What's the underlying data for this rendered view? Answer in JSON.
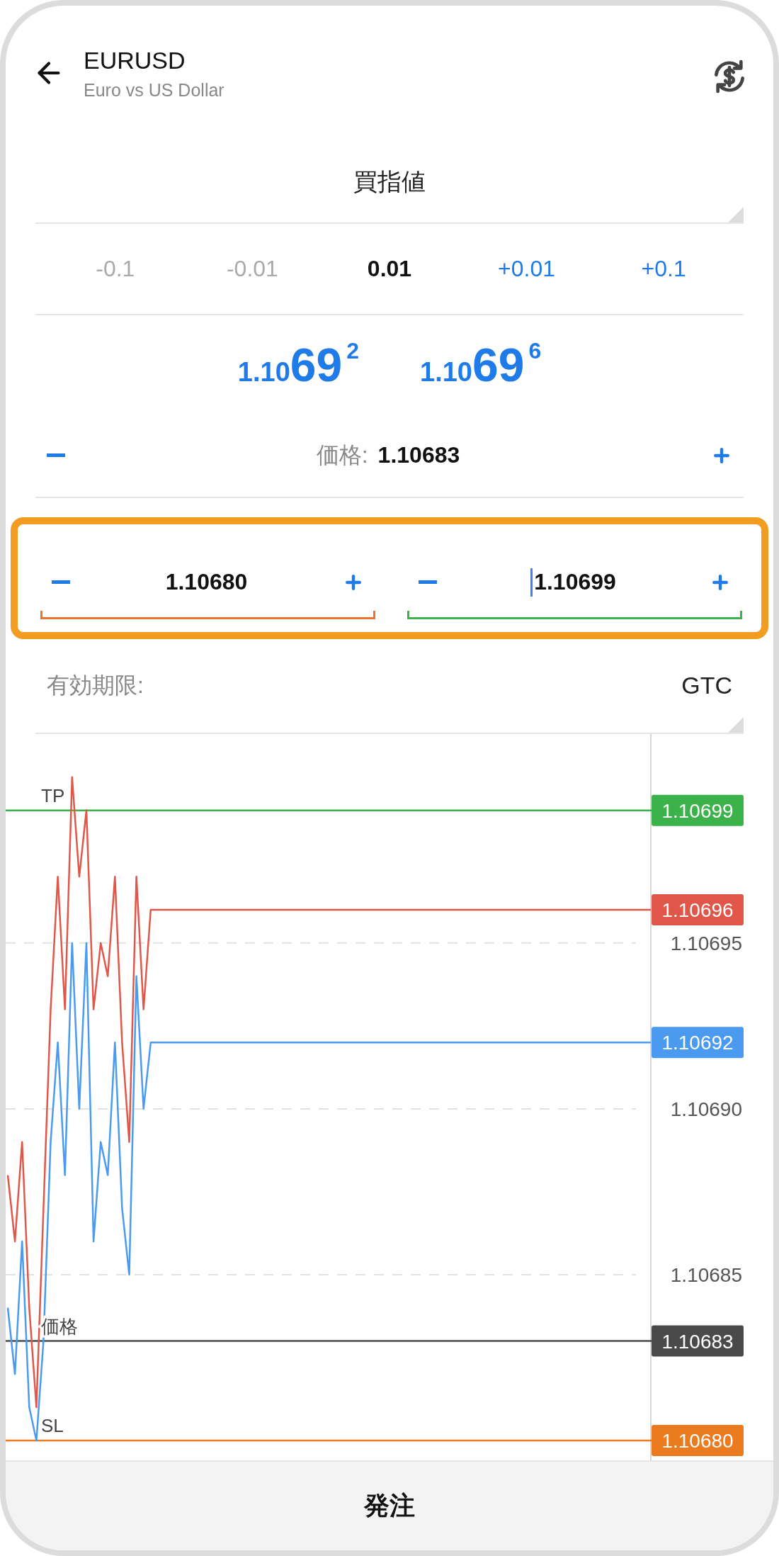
{
  "header": {
    "title": "EURUSD",
    "subtitle": "Euro vs US Dollar"
  },
  "order_type": {
    "value": "買指値"
  },
  "steps": [
    {
      "label": "-0.1",
      "selected": false,
      "disabled": true
    },
    {
      "label": "-0.01",
      "selected": false,
      "disabled": true
    },
    {
      "label": "0.01",
      "selected": true,
      "disabled": false
    },
    {
      "label": "+0.01",
      "selected": false,
      "disabled": false
    },
    {
      "label": "+0.1",
      "selected": false,
      "disabled": false
    }
  ],
  "quotes": [
    {
      "prefix": "1.10",
      "pips": "69",
      "fraction": "2"
    },
    {
      "prefix": "1.10",
      "pips": "69",
      "fraction": "6"
    }
  ],
  "price": {
    "label": "価格:",
    "value": "1.10683"
  },
  "sl_tp": {
    "highlighted": true,
    "fields": [
      {
        "value": "1.10680",
        "color": "#e8762b",
        "focused": false
      },
      {
        "value": "1.10699",
        "color": "#3cb34a",
        "focused": true
      }
    ]
  },
  "expiry": {
    "label": "有効期限:",
    "value": "GTC"
  },
  "chart": {
    "chart_data": {
      "type": "line",
      "categories": [
        null,
        null,
        null,
        null,
        null,
        null,
        null,
        null,
        null,
        null,
        null,
        null,
        null,
        null,
        null,
        null,
        null,
        null,
        null,
        null,
        null,
        null,
        null,
        null,
        null,
        null,
        null,
        null,
        null,
        null,
        null,
        null,
        null,
        null,
        null,
        null,
        null,
        null,
        null,
        null,
        null,
        null,
        null,
        null,
        null,
        null,
        null,
        null,
        null,
        null,
        null,
        null,
        null,
        null,
        null,
        null,
        null,
        null,
        null,
        null,
        null,
        null,
        null,
        null,
        null,
        null,
        null,
        null,
        null,
        null,
        null,
        null,
        null,
        null,
        null,
        null,
        null,
        null,
        null,
        null,
        null,
        null,
        null,
        null,
        null,
        null,
        null,
        null,
        null,
        null,
        null
      ],
      "grid": true,
      "ylim": [
        1.106794,
        1.107013
      ],
      "yticks": [
        {
          "value": 1.10685,
          "label": "1.10685"
        },
        {
          "value": 1.1069,
          "label": "1.10690"
        },
        {
          "value": 1.10695,
          "label": "1.10695"
        }
      ],
      "series": [
        {
          "color": "#e0574a",
          "values": [
            1.10688,
            1.10686,
            1.10689,
            1.10684,
            1.10681,
            1.10687,
            1.10693,
            1.10697,
            1.10693,
            1.107,
            1.10697,
            1.10699,
            1.10693,
            1.10695,
            1.10694,
            1.10697,
            1.10692,
            1.10689,
            1.10697,
            1.10693,
            1.10696,
            1.10696,
            1.10696,
            1.10696,
            1.10696,
            1.10696,
            1.10696,
            1.10696,
            1.10696,
            1.10696,
            1.10696,
            1.10696,
            1.10696,
            1.10696,
            1.10696,
            1.10696,
            1.10696,
            1.10696,
            1.10696,
            1.10696,
            1.10696,
            1.10696,
            1.10696,
            1.10696,
            1.10696,
            1.10696,
            1.10696,
            1.10696,
            1.10696,
            1.10696,
            1.10696,
            1.10696,
            1.10696,
            1.10696,
            1.10696,
            1.10696,
            1.10696,
            1.10696,
            1.10696,
            1.10696,
            1.10696,
            1.10696,
            1.10696,
            1.10696,
            1.10696,
            1.10696,
            1.10696,
            1.10696,
            1.10696,
            1.10696,
            1.10696,
            1.10696,
            1.10696,
            1.10696,
            1.10696,
            1.10696,
            1.10696,
            1.10696,
            1.10696,
            1.10696,
            1.10696,
            1.10696,
            1.10696,
            1.10696,
            1.10696,
            1.10696,
            1.10696,
            1.10696,
            1.10696,
            1.10696,
            1.10696
          ]
        },
        {
          "color": "#4a9bf0",
          "values": [
            1.10684,
            1.10682,
            1.10686,
            1.10681,
            1.1068,
            1.10683,
            1.10689,
            1.10692,
            1.10688,
            1.10695,
            1.1069,
            1.10695,
            1.10686,
            1.10689,
            1.10688,
            1.10692,
            1.10687,
            1.10685,
            1.10694,
            1.1069,
            1.10692,
            1.10692,
            1.10692,
            1.10692,
            1.10692,
            1.10692,
            1.10692,
            1.10692,
            1.10692,
            1.10692,
            1.10692,
            1.10692,
            1.10692,
            1.10692,
            1.10692,
            1.10692,
            1.10692,
            1.10692,
            1.10692,
            1.10692,
            1.10692,
            1.10692,
            1.10692,
            1.10692,
            1.10692,
            1.10692,
            1.10692,
            1.10692,
            1.10692,
            1.10692,
            1.10692,
            1.10692,
            1.10692,
            1.10692,
            1.10692,
            1.10692,
            1.10692,
            1.10692,
            1.10692,
            1.10692,
            1.10692,
            1.10692,
            1.10692,
            1.10692,
            1.10692,
            1.10692,
            1.10692,
            1.10692,
            1.10692,
            1.10692,
            1.10692,
            1.10692,
            1.10692,
            1.10692,
            1.10692,
            1.10692,
            1.10692,
            1.10692,
            1.10692,
            1.10692,
            1.10692,
            1.10692,
            1.10692,
            1.10692,
            1.10692,
            1.10692,
            1.10692,
            1.10692,
            1.10692,
            1.10692,
            1.10692
          ]
        }
      ],
      "value_labels": [
        "1.10696",
        "1.10692"
      ],
      "ref_lines": [
        {
          "axis": "y",
          "value": 1.10699,
          "label": "1.10699",
          "color": "#3cb34a"
        },
        {
          "axis": "y",
          "value": 1.10683,
          "label": "1.10683",
          "color": "#4a4a4a"
        },
        {
          "axis": "y",
          "value": 1.1068,
          "label": "1.10680",
          "color": "#ec7a1f"
        }
      ],
      "annotations": [
        "TP",
        "価格",
        "SL"
      ]
    }
  },
  "footer": {
    "button": "発注"
  }
}
